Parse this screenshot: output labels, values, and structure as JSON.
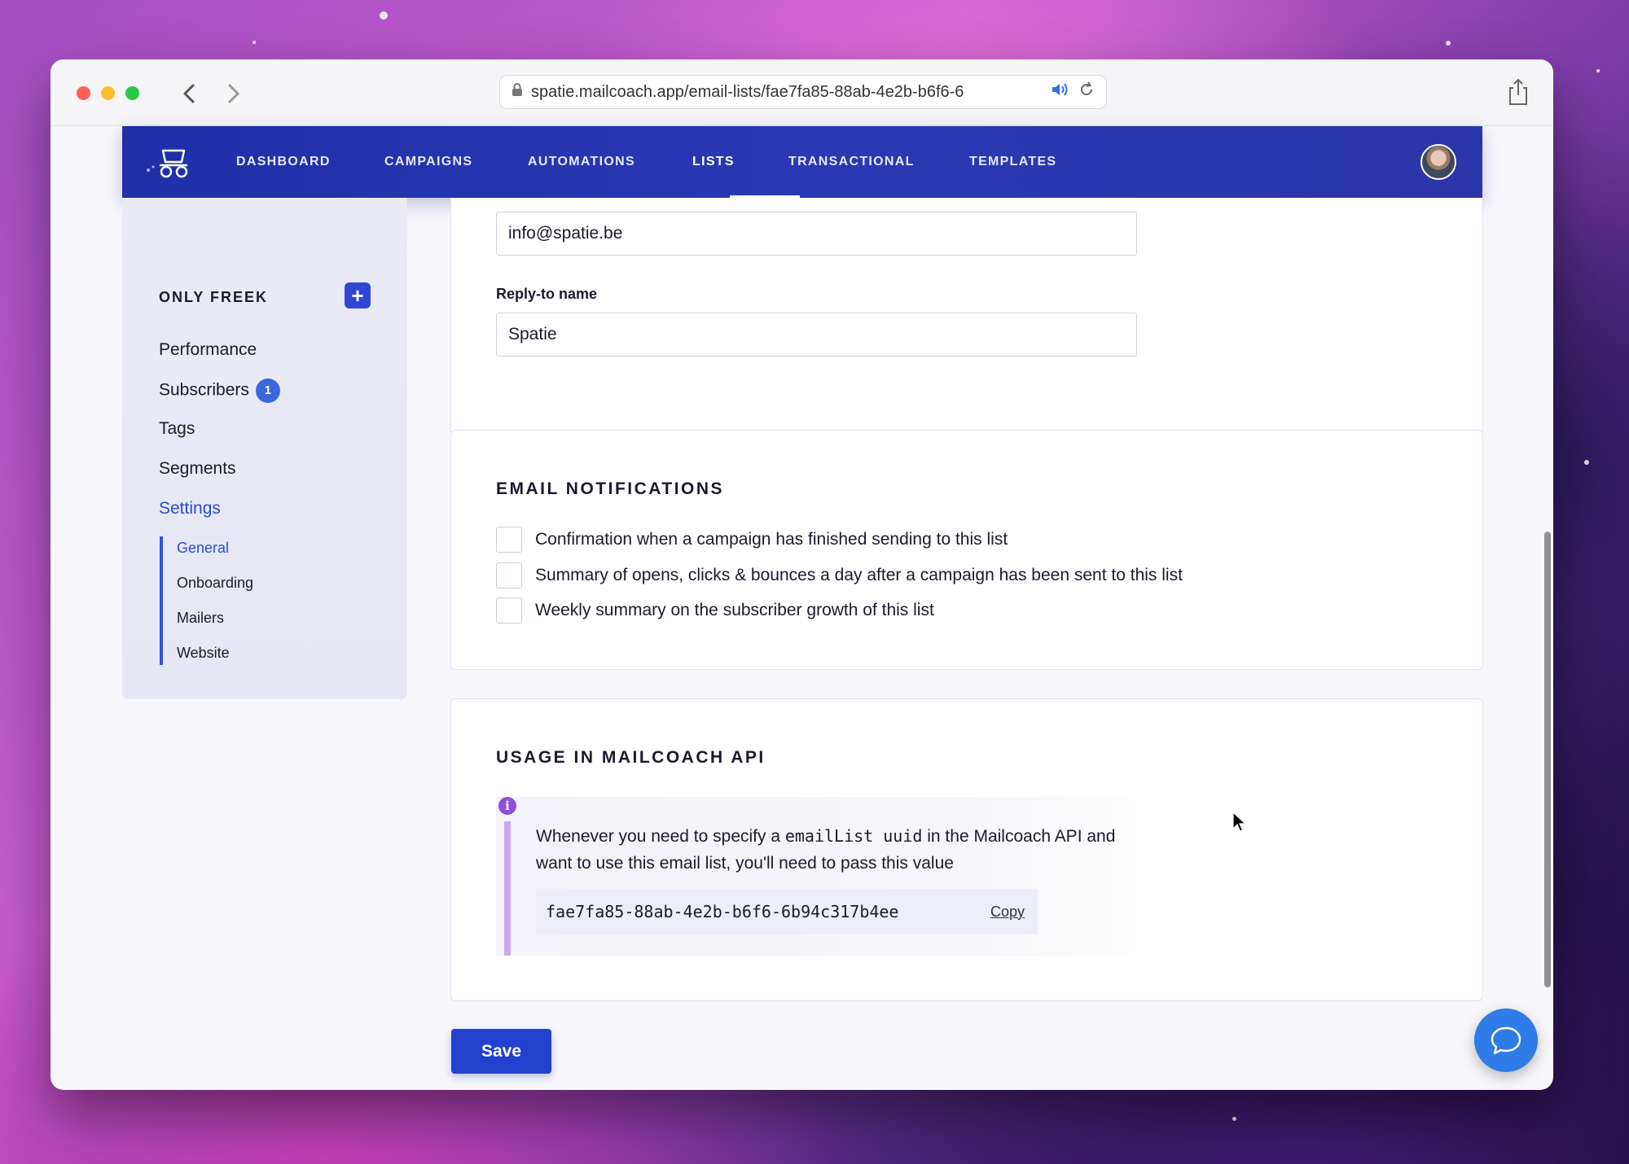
{
  "browser": {
    "url": "spatie.mailcoach.app/email-lists/fae7fa85-88ab-4e2b-b6f6-6",
    "back_icon": "chevron-left-icon",
    "forward_icon": "chevron-right-icon",
    "lock_icon": "lock-icon",
    "audio_icon": "speaker-icon",
    "reload_icon": "reload-icon",
    "share_icon": "share-icon"
  },
  "nav": {
    "items": [
      {
        "label": "DASHBOARD"
      },
      {
        "label": "CAMPAIGNS"
      },
      {
        "label": "AUTOMATIONS"
      },
      {
        "label": "LISTS"
      },
      {
        "label": "TRANSACTIONAL"
      },
      {
        "label": "TEMPLATES"
      }
    ],
    "active": "LISTS"
  },
  "sidebar": {
    "title": "ONLY FREEK",
    "add_label": "+",
    "items": [
      {
        "label": "Performance"
      },
      {
        "label": "Subscribers",
        "badge": "1"
      },
      {
        "label": "Tags"
      },
      {
        "label": "Segments"
      },
      {
        "label": "Settings"
      }
    ],
    "sub_items": [
      {
        "label": "General"
      },
      {
        "label": "Onboarding"
      },
      {
        "label": "Mailers"
      },
      {
        "label": "Website"
      }
    ]
  },
  "reply_section": {
    "reply_to_email_value": "info@spatie.be",
    "reply_to_name_label": "Reply-to name",
    "reply_to_name_value": "Spatie"
  },
  "notifications": {
    "title": "EMAIL NOTIFICATIONS",
    "options": [
      {
        "label": "Confirmation when a campaign has finished sending to this list",
        "checked": false
      },
      {
        "label": "Summary of opens, clicks & bounces a day after a campaign has been sent to this list",
        "checked": false
      },
      {
        "label": "Weekly summary on the subscriber growth of this list",
        "checked": false
      }
    ]
  },
  "api": {
    "title": "USAGE IN MAILCOACH API",
    "info_icon": "i",
    "text_before": "Whenever you need to specify a ",
    "code": "emailList uuid",
    "text_after": " in the Mailcoach API and want to use this email list, you'll need to pass this value",
    "uuid": "fae7fa85-88ab-4e2b-b6f6-6b94c317b4ee",
    "copy_label": "Copy"
  },
  "footer": {
    "save_label": "Save"
  },
  "colors": {
    "nav_bg": "#2a38b5",
    "accent": "#2440cf",
    "badge": "#3a66e0",
    "info_bar": "#c9a8f0",
    "chat": "#2f7be8"
  }
}
